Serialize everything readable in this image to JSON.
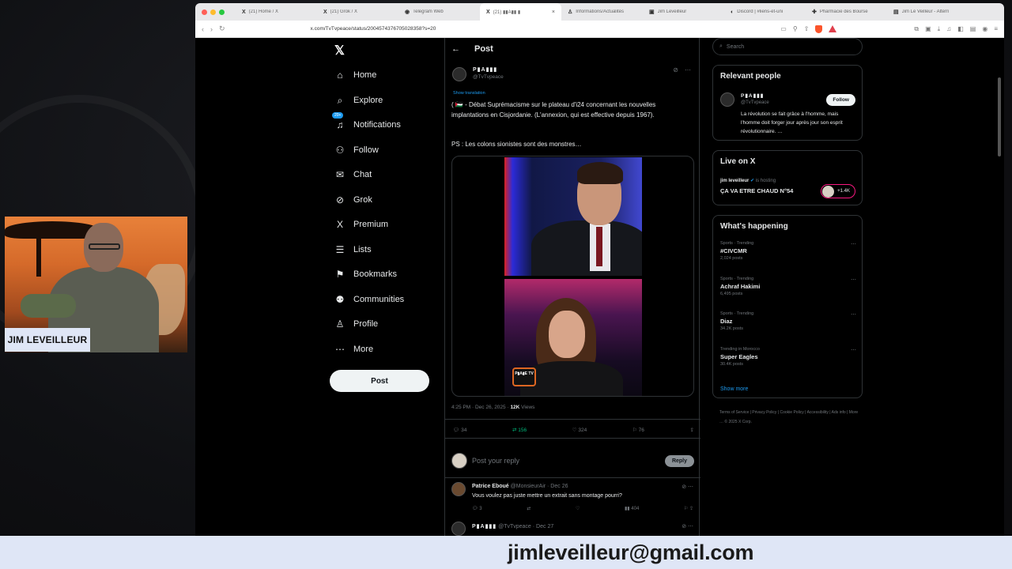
{
  "presenter": {
    "name": "JIM LEVEILLEUR"
  },
  "banner": {
    "email": "jimleveilleur@gmail.com"
  },
  "browser": {
    "tabs": [
      {
        "label": "(21) Home / X",
        "icon": "X"
      },
      {
        "label": "(21) Grok / X",
        "icon": "X"
      },
      {
        "label": "Telegram Web",
        "icon": "◉"
      },
      {
        "label": "(21) ▮▮A▮▮ ▮",
        "icon": "X",
        "active": true
      },
      {
        "label": "Informations/Actualités",
        "icon": "♙"
      },
      {
        "label": "Jim Leveilleur",
        "icon": "▣"
      },
      {
        "label": "Discord | #liens-et-uni",
        "icon": "◐"
      },
      {
        "label": "Pharmacie des Bourse",
        "icon": "✚"
      },
      {
        "label": "Jim Le Veilleur - Altern",
        "icon": "▤"
      }
    ],
    "url": "x.com/TvTvpeace/status/2004574376705028358?s=20"
  },
  "nav": {
    "items": [
      {
        "label": "Home",
        "icon": "⌂"
      },
      {
        "label": "Explore",
        "icon": "⌕"
      },
      {
        "label": "Notifications",
        "icon": "♫",
        "badge": "20+"
      },
      {
        "label": "Follow",
        "icon": "⚇"
      },
      {
        "label": "Chat",
        "icon": "✉"
      },
      {
        "label": "Grok",
        "icon": "⊘"
      },
      {
        "label": "Premium",
        "icon": "X"
      },
      {
        "label": "Lists",
        "icon": "☰"
      },
      {
        "label": "Bookmarks",
        "icon": "⚑"
      },
      {
        "label": "Communities",
        "icon": "⚉"
      },
      {
        "label": "Profile",
        "icon": "♙"
      },
      {
        "label": "More",
        "icon": "⋯"
      }
    ],
    "post_button": "Post"
  },
  "post": {
    "header": "Post",
    "author_name": "P▮A▮▮▮",
    "handle": "@TvTvpeace",
    "show_translation": "Show translation",
    "text": "( 🇵🇸 - Débat Suprémacisme sur le plateau d'i24 concernant les nouvelles implantations en Cisjordanie. (L'annexion, qui est effective depuis 1967).",
    "ps": "PS : Les colons sionistes sont des monstres…",
    "media_logo": "P▮A▮E TV",
    "timestamp": "4:25 PM · Dec 26, 2025 · ",
    "views_count": "12K",
    "views_label": " Views",
    "actions": {
      "replies": "34",
      "reposts": "156",
      "likes": "324",
      "bookmarks": "76"
    },
    "reply_placeholder": "Post your reply",
    "reply_button": "Reply"
  },
  "comments": [
    {
      "name": "Patrice Eboué",
      "handle_date": "@MonsieurAir · Dec 26",
      "text": "Vous voulez pas juste mettre un extrait sans montage pourri?",
      "replies": "3",
      "views": "404"
    },
    {
      "name": "P▮A▮▮▮",
      "handle_date": "@TvTvpeace · Dec 27"
    }
  ],
  "sidebar": {
    "search_placeholder": "Search",
    "relevant": {
      "title": "Relevant people",
      "name": "P▮A▮▮▮",
      "handle": "@TvTvpeace",
      "follow": "Follow",
      "bio": "La révolution se fait grâce à l'homme, mais l'homme doit forger jour après jour son esprit révolutionnaire. …"
    },
    "live": {
      "title": "Live on X",
      "host": "jim leveilleur",
      "status": "is hosting",
      "stream_title": "ÇA VA ETRE CHAUD N°54",
      "listeners": "+1.4K"
    },
    "happening": {
      "title": "What's happening",
      "trends": [
        {
          "context": "Sports · Trending",
          "name": "#CIVCMR",
          "posts": "2,024 posts"
        },
        {
          "context": "Sports · Trending",
          "name": "Achraf Hakimi",
          "posts": "6,495 posts"
        },
        {
          "context": "Sports · Trending",
          "name": "Diaz",
          "posts": "34.2K posts"
        },
        {
          "context": "Trending in Morocco",
          "name": "Super Eagles",
          "posts": "30.4K posts"
        }
      ],
      "show_more": "Show more"
    },
    "footer": "Terms of Service  |  Privacy Policy  |  Cookie Policy  |  Accessibility  |  Ads info  |  More …  © 2025 X Corp."
  }
}
